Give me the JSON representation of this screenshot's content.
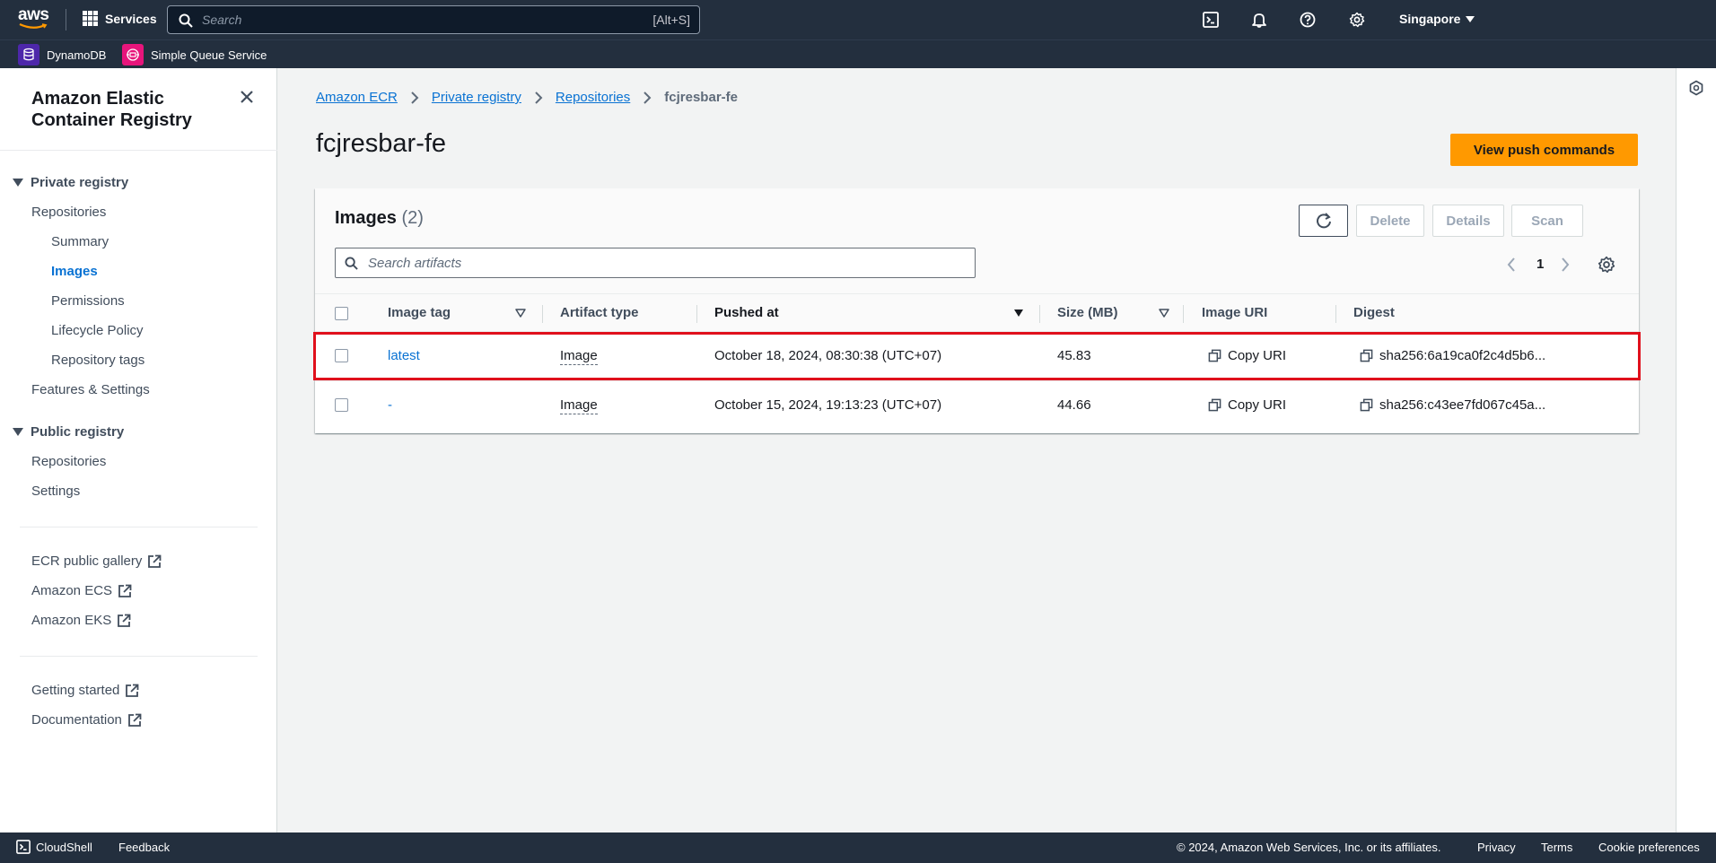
{
  "topnav": {
    "logo_text": "aws",
    "services_label": "Services",
    "search_placeholder": "Search",
    "search_shortcut": "[Alt+S]",
    "region": "Singapore"
  },
  "favorites": [
    {
      "label": "DynamoDB",
      "color": "#4d27aa"
    },
    {
      "label": "Simple Queue Service",
      "color": "#e7157b"
    }
  ],
  "sidebar": {
    "title": "Amazon Elastic Container Registry",
    "private_section": "Private registry",
    "private_items": [
      {
        "label": "Repositories"
      },
      {
        "label": "Summary"
      },
      {
        "label": "Images"
      },
      {
        "label": "Permissions"
      },
      {
        "label": "Lifecycle Policy"
      },
      {
        "label": "Repository tags"
      },
      {
        "label": "Features & Settings"
      }
    ],
    "public_section": "Public registry",
    "public_items": [
      {
        "label": "Repositories"
      },
      {
        "label": "Settings"
      }
    ],
    "external_links": [
      {
        "label": "ECR public gallery"
      },
      {
        "label": "Amazon ECS"
      },
      {
        "label": "Amazon EKS"
      }
    ],
    "help_links": [
      {
        "label": "Getting started"
      },
      {
        "label": "Documentation"
      }
    ]
  },
  "breadcrumb": [
    {
      "label": "Amazon ECR"
    },
    {
      "label": "Private registry"
    },
    {
      "label": "Repositories"
    },
    {
      "label": "fcjresbar-fe"
    }
  ],
  "page": {
    "title": "fcjresbar-fe",
    "primary_action": "View push commands"
  },
  "images_panel": {
    "title": "Images",
    "count": "(2)",
    "actions": {
      "delete": "Delete",
      "details": "Details",
      "scan": "Scan"
    },
    "filter_placeholder": "Search artifacts",
    "page_number": "1",
    "columns": [
      "Image tag",
      "Artifact type",
      "Pushed at",
      "Size (MB)",
      "Image URI",
      "Digest"
    ],
    "rows": [
      {
        "tag": "latest",
        "artifact_type": "Image",
        "pushed_at": "October 18, 2024, 08:30:38 (UTC+07)",
        "size": "45.83",
        "uri_action": "Copy URI",
        "digest": "sha256:6a19ca0f2c4d5b6..."
      },
      {
        "tag": "-",
        "artifact_type": "Image",
        "pushed_at": "October 15, 2024, 19:13:23 (UTC+07)",
        "size": "44.66",
        "uri_action": "Copy URI",
        "digest": "sha256:c43ee7fd067c45a..."
      }
    ]
  },
  "footer": {
    "cloudshell": "CloudShell",
    "feedback": "Feedback",
    "copyright": "© 2024, Amazon Web Services, Inc. or its affiliates.",
    "privacy": "Privacy",
    "terms": "Terms",
    "cookies": "Cookie preferences"
  },
  "colors": {
    "nav_bg": "#232f3e",
    "link": "#0972d3",
    "primary_button": "#ff9900",
    "highlight": "#e0101c"
  }
}
